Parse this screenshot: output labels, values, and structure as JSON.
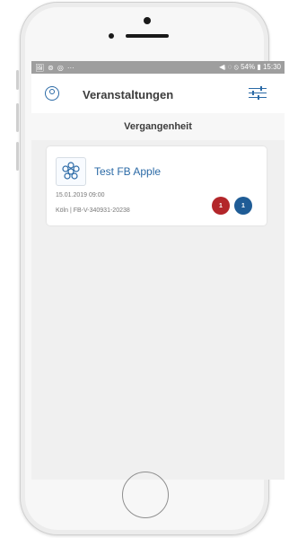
{
  "status_bar": {
    "left_icons": [
      "🖼",
      "⊚",
      "◎",
      "···"
    ],
    "right_text": "◀ᵢ  ◌  ⦸ 54% ▮ 15:30"
  },
  "header": {
    "title": "Veranstaltungen"
  },
  "section": {
    "label": "Vergangenheit"
  },
  "event": {
    "title": "Test FB Apple",
    "datetime": "15.01.2019 09:00",
    "location": "Köln | FB-V-340931-20238",
    "badge_red": "1",
    "badge_blue": "1"
  },
  "colors": {
    "accent": "#2b6aa6",
    "badge_red": "#b3262a",
    "badge_blue": "#1f5c96",
    "status_bar": "#9e9e9e"
  }
}
